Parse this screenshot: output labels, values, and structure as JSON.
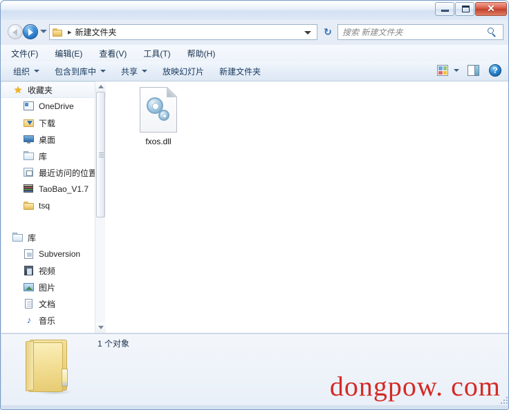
{
  "window": {
    "controls": {
      "minimize_label": "–",
      "maximize_label": "□",
      "close_label": "✕"
    }
  },
  "address_bar": {
    "back_tooltip": "后退",
    "forward_tooltip": "前进",
    "crumb_separator": "▸",
    "path": "新建文件夹",
    "refresh_label": "↻"
  },
  "search": {
    "placeholder": "搜索 新建文件夹",
    "value": ""
  },
  "menubar": {
    "items": [
      {
        "label": "文件(F)"
      },
      {
        "label": "编辑(E)"
      },
      {
        "label": "查看(V)"
      },
      {
        "label": "工具(T)"
      },
      {
        "label": "帮助(H)"
      }
    ]
  },
  "command_bar": {
    "items": [
      {
        "label": "组织",
        "has_caret": true
      },
      {
        "label": "包含到库中",
        "has_caret": true
      },
      {
        "label": "共享",
        "has_caret": true
      },
      {
        "label": "放映幻灯片",
        "has_caret": false
      },
      {
        "label": "新建文件夹",
        "has_caret": false
      }
    ],
    "help_label": "?"
  },
  "sidebar": {
    "groups": [
      {
        "header": {
          "label": "收藏夹",
          "icon": "star-icon",
          "selected": true
        },
        "items": [
          {
            "label": "OneDrive",
            "icon": "onedrive-icon"
          },
          {
            "label": "下载",
            "icon": "download-icon"
          },
          {
            "label": "桌面",
            "icon": "desktop-icon"
          },
          {
            "label": "库",
            "icon": "library-icon"
          },
          {
            "label": "最近访问的位置",
            "icon": "recent-places-icon"
          },
          {
            "label": "TaoBao_V1.7",
            "icon": "archive-icon"
          },
          {
            "label": "tsq",
            "icon": "folder-icon"
          }
        ]
      },
      {
        "header": {
          "label": "库",
          "icon": "library-icon",
          "selected": false
        },
        "items": [
          {
            "label": "Subversion",
            "icon": "subversion-icon"
          },
          {
            "label": "视频",
            "icon": "video-icon"
          },
          {
            "label": "图片",
            "icon": "picture-icon"
          },
          {
            "label": "文档",
            "icon": "document-icon"
          },
          {
            "label": "音乐",
            "icon": "music-icon"
          }
        ]
      }
    ]
  },
  "content": {
    "files": [
      {
        "name": "fxos.dll",
        "icon": "dll-gear-icon"
      }
    ]
  },
  "status_bar": {
    "object_count": "1 个对象",
    "folder_icon": "open-folder-icon"
  },
  "watermark": {
    "text": "dongpow. com",
    "color": "#d42a25"
  }
}
